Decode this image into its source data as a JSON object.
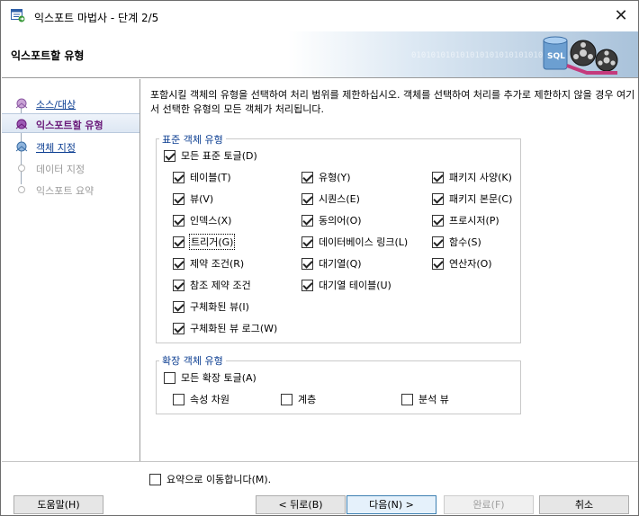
{
  "window": {
    "title": "익스포트 마법사 - 단계 2/5",
    "close_glyph": "✕"
  },
  "header": {
    "page_title": "익스포트할 유형",
    "binary_decor": "01010101010101010101010101010"
  },
  "nav": {
    "items": [
      {
        "label": "소스/대상",
        "state": "link"
      },
      {
        "label": "익스포트할 유형",
        "state": "active"
      },
      {
        "label": "객체 지정",
        "state": "link"
      },
      {
        "label": "데이터 지정",
        "state": "disabled"
      },
      {
        "label": "익스포트 요약",
        "state": "disabled"
      }
    ]
  },
  "main": {
    "description": "포함시킬 객체의 유형을 선택하여 처리 범위를 제한하십시오. 객체를 선택하여 처리를 추가로 제한하지 않을 경우 여기서 선택한 유형의 모든 객체가 처리됩니다.",
    "standard": {
      "title": "표준 객체 유형",
      "toggle_all": "모든 표준 토글(D)",
      "items": [
        "테이블(T)",
        "유형(Y)",
        "패키지 사양(K)",
        "뷰(V)",
        "시퀀스(E)",
        "패키지 본문(C)",
        "인덱스(X)",
        "동의어(O)",
        "프로시저(P)",
        "트리거(G)",
        "데이터베이스 링크(L)",
        "함수(S)",
        "제약 조건(R)",
        "대기열(Q)",
        "연산자(O)",
        "참조 제약 조건",
        "대기열 테이블(U)",
        "구체화된 뷰(I)",
        "구체화된 뷰 로그(W)"
      ]
    },
    "extended": {
      "title": "확장 객체 유형",
      "toggle_all": "모든 확장 토글(A)",
      "items": [
        "속성 차원",
        "계층",
        "분석 뷰"
      ]
    },
    "summary_check": "요약으로 이동합니다(M)."
  },
  "buttons": {
    "help": "도움말(H)",
    "back": "< 뒤로(B)",
    "next": "다음(N) >",
    "finish": "완료(F)",
    "cancel": "취소"
  },
  "colors": {
    "link": "#0b3d91",
    "active_label": "#6a1a7a",
    "primary_border": "#3c7fb1"
  }
}
